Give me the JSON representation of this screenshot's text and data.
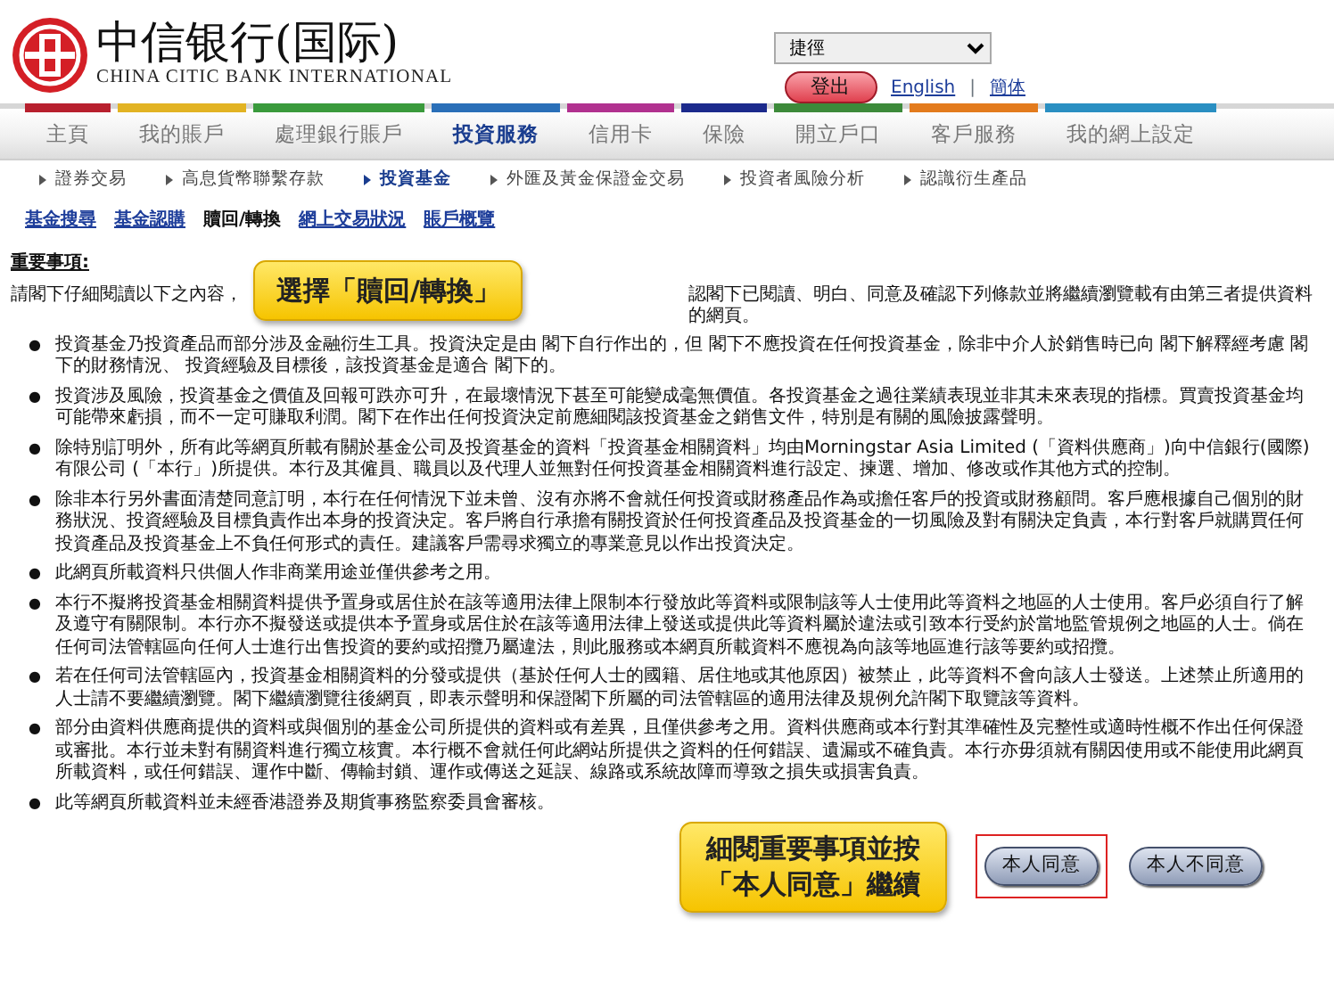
{
  "logo": {
    "name_zh": "中信银行(国际)",
    "name_en": "CHINA CITIC BANK INTERNATIONAL"
  },
  "shortcut_select": {
    "value": "捷徑"
  },
  "logout_button": "登出",
  "language_links": {
    "items": [
      "English",
      "簡体"
    ],
    "separator": "|"
  },
  "main_nav": [
    {
      "label": "主頁",
      "color": "#b8202e",
      "selected": false
    },
    {
      "label": "我的賬戶",
      "color": "#e2b323",
      "selected": false
    },
    {
      "label": "處理銀行賬戶",
      "color": "#3a9a3c",
      "selected": false
    },
    {
      "label": "投資服務",
      "color": "#2a6fb8",
      "selected": true
    },
    {
      "label": "信用卡",
      "color": "#b1318f",
      "selected": false
    },
    {
      "label": "保險",
      "color": "#1c2a8c",
      "selected": false
    },
    {
      "label": "開立戶口",
      "color": "#3d8a3a",
      "selected": false
    },
    {
      "label": "客戶服務",
      "color": "#e37b1d",
      "selected": false
    },
    {
      "label": "我的網上設定",
      "color": "#2a8fc2",
      "selected": false
    }
  ],
  "sub_nav": [
    {
      "label": "證券交易",
      "selected": false
    },
    {
      "label": "高息貨幣聯繫存款",
      "selected": false
    },
    {
      "label": "投資基金",
      "selected": true
    },
    {
      "label": "外匯及黃金保證金交易",
      "selected": false
    },
    {
      "label": "投資者風險分析",
      "selected": false
    },
    {
      "label": "認識衍生產品",
      "selected": false
    }
  ],
  "fund_tabs": [
    {
      "label": "基金搜尋",
      "selected": false
    },
    {
      "label": "基金認購",
      "selected": false
    },
    {
      "label": "贖回/轉換",
      "selected": true
    },
    {
      "label": "網上交易狀況",
      "selected": false
    },
    {
      "label": "賬戶概覽",
      "selected": false
    }
  ],
  "notice": {
    "title": "重要事項:",
    "bullet": "●",
    "intro_before": "請閣下仔細閱讀以下之內容，",
    "intro_after": "認閣下已閱讀、明白、同意及確認下列條款並將繼續瀏覽載有由第三者提供資料的網頁。",
    "items": [
      "投資基金乃投資產品而部分涉及金融衍生工具。投資決定是由 閣下自行作出的，但 閣下不應投資在任何投資基金，除非中介人於銷售時已向 閣下解釋經考慮 閣下的財務情況、 投資經驗及目標後，該投資基金是適合 閣下的。",
      "投資涉及風險，投資基金之價值及回報可跌亦可升，在最壞情況下甚至可能變成毫無價值。各投資基金之過往業績表現並非其未來表現的指標。買賣投資基金均可能帶來虧損，而不一定可賺取利潤。閣下在作出任何投資決定前應細閱該投資基金之銷售文件，特別是有關的風險披露聲明。",
      "除特別訂明外，所有此等網頁所載有關於基金公司及投資基金的資料「投資基金相關資料」均由Morningstar Asia Limited (「資料供應商」)向中信銀行(國際)有限公司 (「本行」)所提供。本行及其僱員、職員以及代理人並無對任何投資基金相關資料進行設定、揀選、增加、修改或作其他方式的控制。",
      "除非本行另外書面清楚同意訂明，本行在任何情況下並未曾、沒有亦將不會就任何投資或財務產品作為或擔任客戶的投資或財務顧問。客戶應根據自己個別的財務狀況、投資經驗及目標負責作出本身的投資決定。客戶將自行承擔有關投資於任何投資產品及投資基金的一切風險及對有關決定負責，本行對客戶就購買任何投資產品及投資基金上不負任何形式的責任。建議客戶需尋求獨立的專業意見以作出投資決定。",
      "此網頁所載資料只供個人作非商業用途並僅供參考之用。",
      "本行不擬將投資基金相關資料提供予置身或居住於在該等適用法律上限制本行發放此等資料或限制該等人士使用此等資料之地區的人士使用。客戶必須自行了解及遵守有關限制。本行亦不擬發送或提供本予置身或居住於在該等適用法律上發送或提供此等資料屬於違法或引致本行受約於當地監管規例之地區的人士。倘在任何司法管轄區向任何人士進行出售投資的要約或招攬乃屬違法，則此服務或本網頁所載資料不應視為向該等地區進行該等要約或招攬。",
      "若在任何司法管轄區內，投資基金相關資料的分發或提供（基於任何人士的國籍、居住地或其他原因）被禁止，此等資料不會向該人士發送。上述禁止所適用的人士請不要繼續瀏覽。閣下繼續瀏覽往後網頁，即表示聲明和保證閣下所屬的司法管轄區的適用法律及規例允許閣下取覽該等資料。",
      "部分由資料供應商提供的資料或與個別的基金公司所提供的資料或有差異，且僅供參考之用。資料供應商或本行對其準確性及完整性或適時性概不作出任何保證或審批。本行並未對有關資料進行獨立核實。本行概不會就任何此網站所提供之資料的任何錯誤、遺漏或不確負責。本行亦毋須就有關因使用或不能使用此網頁所載資料，或任何錯誤、運作中斷、傳輸封鎖、運作或傳送之延誤、線路或系統故障而導致之損失或損害負責。",
      "此等網頁所載資料並未經香港證券及期貨事務監察委員會審核。"
    ]
  },
  "top_callout": "選擇「贖回/轉換」",
  "bottom_callout": {
    "lines": [
      "細閱重要事項並按",
      "「本人同意」繼續"
    ]
  },
  "buttons": [
    {
      "label": "本人同意",
      "highlighted": true
    },
    {
      "label": "本人不同意",
      "highlighted": false
    }
  ]
}
